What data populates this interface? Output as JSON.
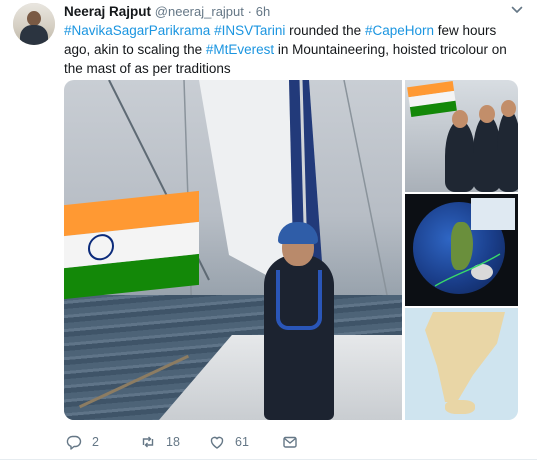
{
  "tweet": {
    "author_name": "Neeraj Rajput",
    "handle": "@neeraj_rajput",
    "separator": "·",
    "time": "6h",
    "text_parts": [
      {
        "text": "#NavikaSagarParikrama",
        "tag": true
      },
      {
        "text": " ",
        "tag": false
      },
      {
        "text": "#INSVTarini",
        "tag": true
      },
      {
        "text": " rounded the ",
        "tag": false
      },
      {
        "text": "#CapeHorn",
        "tag": true
      },
      {
        "text": " few hours ago, akin to scaling the ",
        "tag": false
      },
      {
        "text": "#MtEverest",
        "tag": true
      },
      {
        "text": " in Mountaineering, hoisted tricolour on the mast of as per traditions",
        "tag": false
      }
    ],
    "media": {
      "main_photo": "sailor-with-indian-flag-photo",
      "side_photos": [
        "crew-on-deck-photo",
        "globe-route-map-photo",
        "south-america-map-photo"
      ]
    },
    "actions": {
      "reply_count": "2",
      "retweet_count": "18",
      "like_count": "61"
    },
    "icons": {
      "reply": "reply-icon",
      "retweet": "retweet-icon",
      "like": "heart-icon",
      "dm": "direct-message-icon",
      "menu": "chevron-down-icon"
    },
    "colors": {
      "link": "#1b95e0",
      "secondary_text": "#657786",
      "primary_text": "#14171a"
    }
  }
}
